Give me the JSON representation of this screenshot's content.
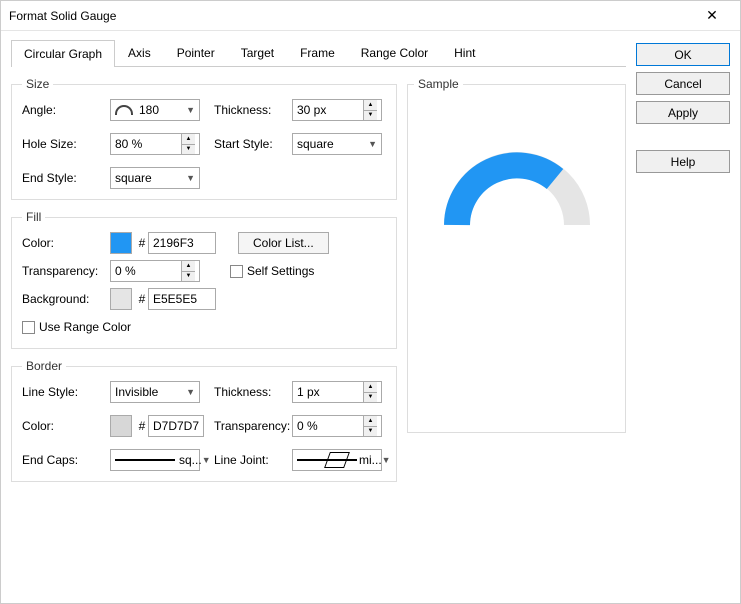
{
  "window": {
    "title": "Format Solid Gauge"
  },
  "tabs": [
    "Circular Graph",
    "Axis",
    "Pointer",
    "Target",
    "Frame",
    "Range Color",
    "Hint"
  ],
  "activeTab": 0,
  "size": {
    "legend": "Size",
    "angle_label": "Angle:",
    "angle_value": "180",
    "thickness_label": "Thickness:",
    "thickness_value": "30 px",
    "holesize_label": "Hole Size:",
    "holesize_value": "80 %",
    "startstyle_label": "Start Style:",
    "startstyle_value": "square",
    "endstyle_label": "End Style:",
    "endstyle_value": "square"
  },
  "fill": {
    "legend": "Fill",
    "color_label": "Color:",
    "color_swatch": "#2196F3",
    "color_hex": "2196F3",
    "colorlist_btn": "Color List...",
    "transparency_label": "Transparency:",
    "transparency_value": "0 %",
    "selfsettings_label": "Self Settings",
    "background_label": "Background:",
    "background_swatch": "#E5E5E5",
    "background_hex": "E5E5E5",
    "userange_label": "Use Range Color"
  },
  "border": {
    "legend": "Border",
    "linestyle_label": "Line Style:",
    "linestyle_value": "Invisible",
    "thickness_label": "Thickness:",
    "thickness_value": "1 px",
    "color_label": "Color:",
    "color_swatch": "#D7D7D7",
    "color_hex": "D7D7D7",
    "transparency_label": "Transparency:",
    "transparency_value": "0 %",
    "endcaps_label": "End Caps:",
    "endcaps_value": "sq...",
    "linejoint_label": "Line Joint:",
    "linejoint_value": "mi..."
  },
  "sample": {
    "legend": "Sample"
  },
  "buttons": {
    "ok": "OK",
    "cancel": "Cancel",
    "apply": "Apply",
    "help": "Help"
  },
  "hash": "#"
}
